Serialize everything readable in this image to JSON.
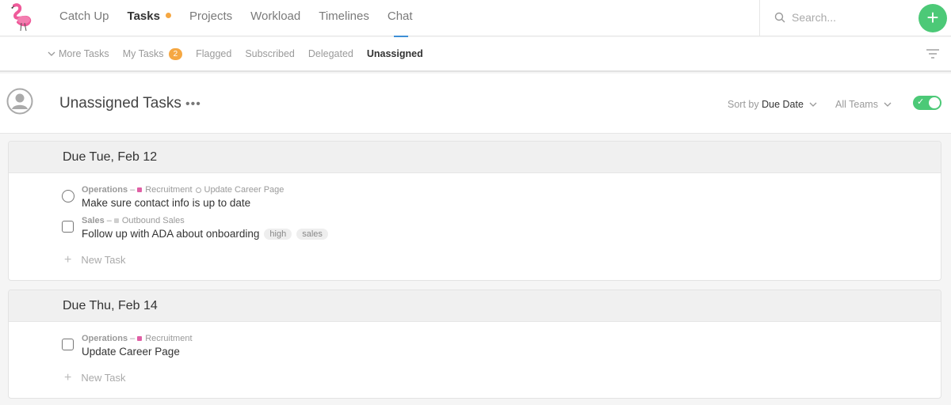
{
  "nav": {
    "items": [
      {
        "label": "Catch Up"
      },
      {
        "label": "Tasks"
      },
      {
        "label": "Projects"
      },
      {
        "label": "Workload"
      },
      {
        "label": "Timelines"
      },
      {
        "label": "Chat"
      }
    ],
    "active": "Tasks",
    "search_placeholder": "Search...",
    "add_label": "+"
  },
  "subnav": {
    "more_tasks": "More Tasks",
    "my_tasks": "My Tasks",
    "my_tasks_count": "2",
    "flagged": "Flagged",
    "subscribed": "Subscribed",
    "delegated": "Delegated",
    "unassigned": "Unassigned"
  },
  "header": {
    "title": "Unassigned Tasks",
    "more": "•••",
    "sort_prefix": "Sort by",
    "sort_value": "Due Date",
    "teams": "All Teams",
    "toggle_on": true
  },
  "groups": [
    {
      "title": "Due Tue, Feb 12",
      "tasks": [
        {
          "team": "Operations",
          "project": "Recruitment",
          "project_color": "#e05fa5",
          "parent": "Update Career Page",
          "name": "Make sure contact info is up to date",
          "check": "circle",
          "tags": []
        },
        {
          "team": "Sales",
          "project": "Outbound Sales",
          "project_color": "#cfcfcf",
          "parent": "",
          "name": "Follow up with ADA about onboarding",
          "check": "box",
          "tags": [
            "high",
            "sales"
          ]
        }
      ],
      "new_task": "New Task"
    },
    {
      "title": "Due Thu, Feb 14",
      "tasks": [
        {
          "team": "Operations",
          "project": "Recruitment",
          "project_color": "#e05fa5",
          "parent": "",
          "name": "Update Career Page",
          "check": "box",
          "tags": []
        }
      ],
      "new_task": "New Task"
    }
  ],
  "colors": {
    "accent_green": "#4cc977",
    "badge_orange": "#f5a742",
    "tab_underline": "#3d8fd6"
  }
}
